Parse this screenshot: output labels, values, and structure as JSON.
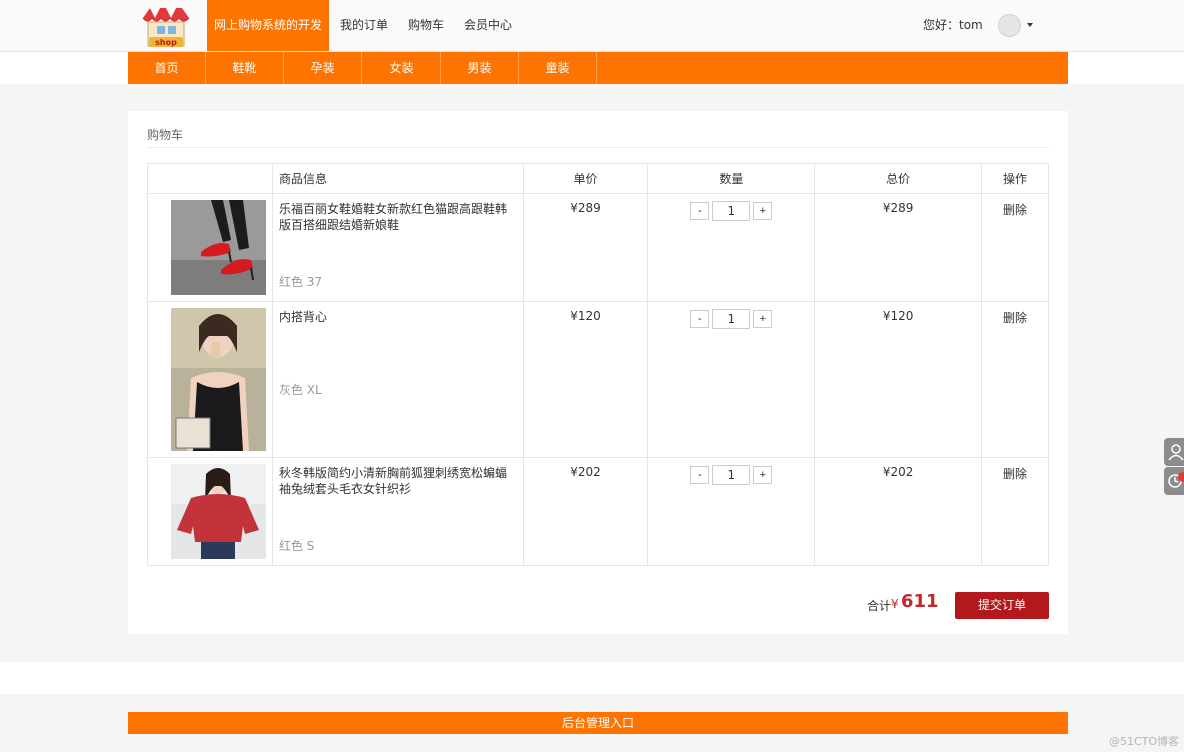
{
  "header": {
    "logo_text": "shop",
    "brand": "网上购物系统的开发",
    "nav": [
      "我的订单",
      "购物车",
      "会员中心"
    ],
    "greeting": "您好：tom"
  },
  "categories": [
    "首页",
    "鞋靴",
    "孕装",
    "女装",
    "男装",
    "童装"
  ],
  "cart": {
    "title": "购物车",
    "columns": {
      "info": "商品信息",
      "price": "单价",
      "qty": "数量",
      "total": "总价",
      "op": "操作"
    },
    "items": [
      {
        "name": "乐福百丽女鞋婚鞋女新款红色猫跟高跟鞋韩版百搭细跟结婚新娘鞋",
        "attr": "红色 37",
        "price": "¥289",
        "qty": "1",
        "total": "¥289",
        "op": "删除",
        "image": "red-heels"
      },
      {
        "name": "内搭背心",
        "attr": "灰色 XL",
        "price": "¥120",
        "qty": "1",
        "total": "¥120",
        "op": "删除",
        "image": "black-vest-woman"
      },
      {
        "name": "秋冬韩版简约小清新胸前狐狸刺绣宽松蝙蝠袖兔绒套头毛衣女针织衫",
        "attr": "红色 S",
        "price": "¥202",
        "qty": "1",
        "total": "¥202",
        "op": "删除",
        "image": "red-sweater-woman"
      }
    ],
    "stepper": {
      "minus": "-",
      "plus": "+"
    },
    "summary": {
      "label": "合计",
      "currency": "¥",
      "value": "611"
    },
    "submit": "提交订单"
  },
  "footer": {
    "admin_link": "后台管理入口"
  },
  "watermark": "@51CTO博客",
  "colors": {
    "accent": "#ff7400",
    "submit": "#b3191c",
    "sum": "#c1272d"
  }
}
